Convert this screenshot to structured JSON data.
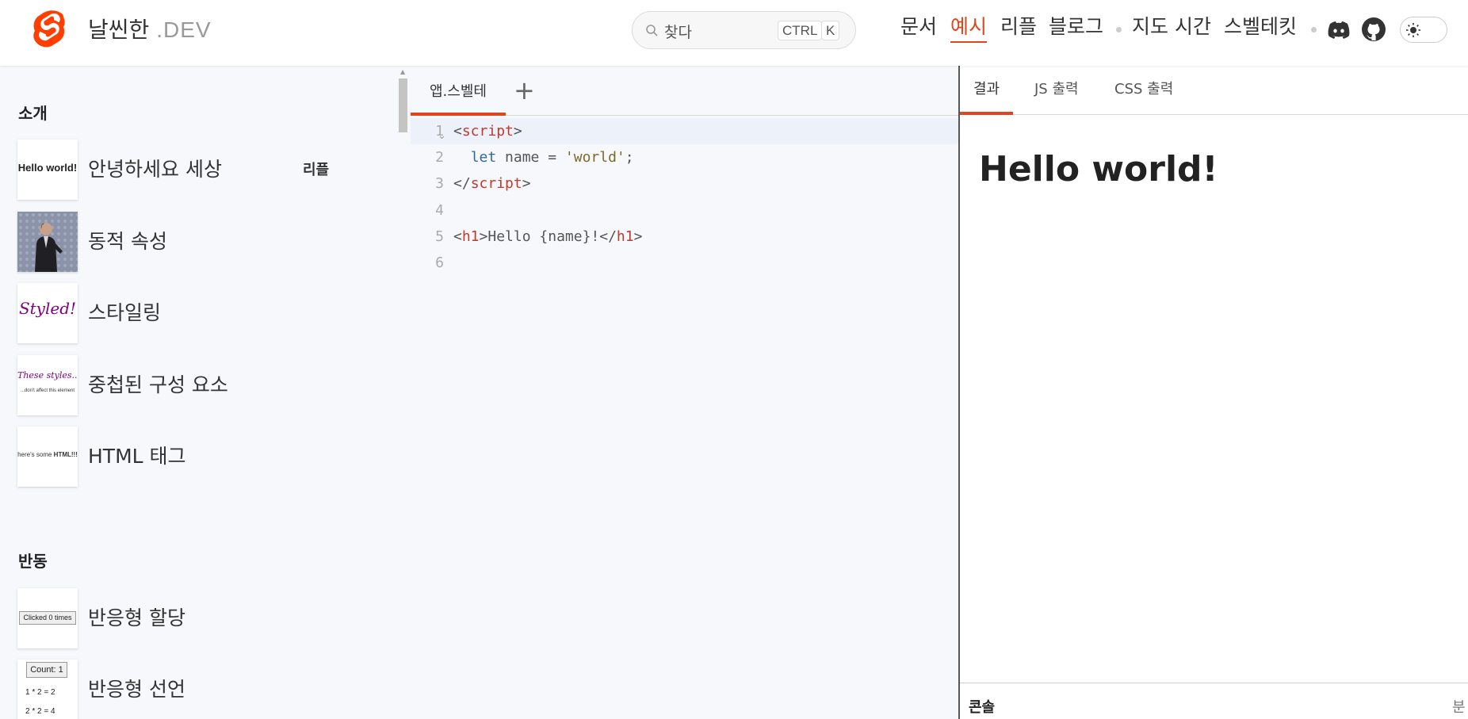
{
  "header": {
    "brand_name": "날씬한",
    "brand_suffix": ".DEV",
    "search_placeholder": "찾다",
    "kbd_ctrl": "CTRL",
    "kbd_k": "K",
    "nav": [
      {
        "label": "문서"
      },
      {
        "label": "예시",
        "active": true
      },
      {
        "label": "리플"
      },
      {
        "label": "블로그"
      },
      {
        "label": "지도 시간"
      },
      {
        "label": "스벨테킷"
      }
    ],
    "icons": [
      "discord-icon",
      "github-icon",
      "sun-icon"
    ],
    "accent_color": "#e0461d"
  },
  "sidebar": {
    "sections": [
      {
        "title": "소개",
        "items": [
          {
            "label": "안녕하세요 세상",
            "thumb_text": "Hello world!",
            "tag": "리플"
          },
          {
            "label": "동적 속성",
            "thumb_text": ""
          },
          {
            "label": "스타일링",
            "thumb_text": "Styled!"
          },
          {
            "label": "중첩된 구성 요소",
            "thumb_text": "These styles...",
            "thumb_subtext": "...don't affect this element"
          },
          {
            "label": "HTML 태그",
            "thumb_text": "here's some",
            "thumb_bold": "HTML!!!"
          }
        ]
      },
      {
        "title": "반동",
        "items": [
          {
            "label": "반응형 할당",
            "thumb_text": "Clicked 0 times"
          },
          {
            "label": "반응형 선언",
            "thumb_text": "Count: 1",
            "thumb_lines": [
              "1 * 2 = 2",
              "2 * 2 = 4"
            ]
          }
        ]
      }
    ]
  },
  "editor": {
    "file_tab": "앱.스벨테",
    "add_tab": "+",
    "line_numbers": [
      "1",
      "2",
      "3",
      "4",
      "5",
      "6"
    ],
    "lines": [
      {
        "tokens": [
          {
            "t": "<",
            "c": ""
          },
          {
            "t": "script",
            "c": "tag"
          },
          {
            "t": ">",
            "c": ""
          }
        ]
      },
      {
        "tokens": [
          {
            "t": "  ",
            "c": ""
          },
          {
            "t": "let",
            "c": "kw"
          },
          {
            "t": " name = ",
            "c": ""
          },
          {
            "t": "'world'",
            "c": "str"
          },
          {
            "t": ";",
            "c": ""
          }
        ]
      },
      {
        "tokens": [
          {
            "t": "</",
            "c": ""
          },
          {
            "t": "script",
            "c": "tag"
          },
          {
            "t": ">",
            "c": ""
          }
        ]
      },
      {
        "tokens": []
      },
      {
        "tokens": [
          {
            "t": "<",
            "c": ""
          },
          {
            "t": "h1",
            "c": "tag"
          },
          {
            "t": ">Hello {name}!</",
            "c": ""
          },
          {
            "t": "h1",
            "c": "tag"
          },
          {
            "t": ">",
            "c": ""
          }
        ]
      },
      {
        "tokens": []
      }
    ]
  },
  "output": {
    "tabs": [
      {
        "label": "결과",
        "active": true
      },
      {
        "label": "JS 출력"
      },
      {
        "label": "CSS 출력"
      }
    ],
    "result_heading": "Hello world!",
    "console_label": "콘솔",
    "console_right": "분"
  }
}
